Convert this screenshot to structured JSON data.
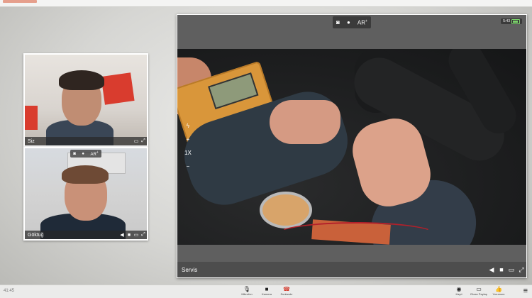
{
  "self_tile": {
    "name": "Siz"
  },
  "peer_tile": {
    "name": "Göktuğ",
    "top_controls": {
      "ar_label": "AR",
      "ar_sup": "+"
    }
  },
  "main_video": {
    "name": "Servis",
    "top_controls": {
      "ar_label": "AR",
      "ar_sup": "+"
    },
    "status_time": "5:43",
    "side_controls": {
      "plus": "+",
      "zoom": "1X",
      "minus": "−"
    }
  },
  "toolbar": {
    "clock": "41:45",
    "center_items": [
      {
        "label": "Mikrofon",
        "icon": "microphone-icon"
      },
      {
        "label": "Kamera",
        "icon": "camera-icon"
      },
      {
        "label": "Sonlandır",
        "icon": "hangup-icon"
      }
    ],
    "right_items": [
      {
        "label": "Kayıt",
        "icon": "record-icon"
      },
      {
        "label": "Ekran Paylaş",
        "icon": "screen-share-icon"
      },
      {
        "label": "Yorumum",
        "icon": "thumbs-up-icon"
      }
    ]
  },
  "colors": {
    "accent_red": "#d33a2c",
    "battery_green": "#7bd16b"
  }
}
